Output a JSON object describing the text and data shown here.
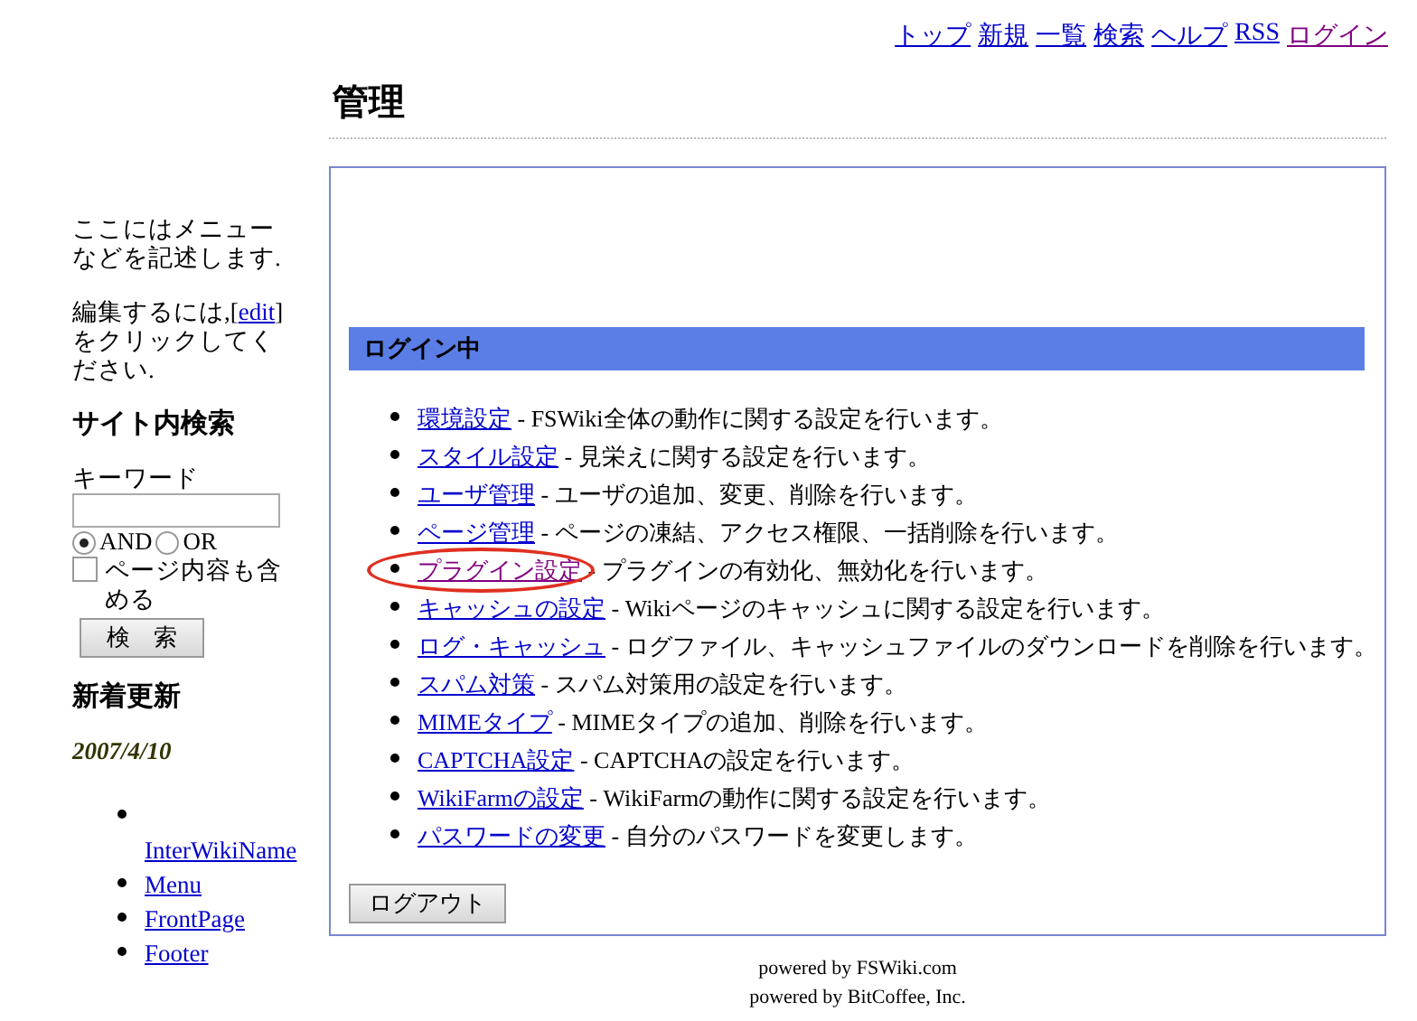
{
  "top_nav": [
    {
      "label": "トップ",
      "visited": false
    },
    {
      "label": "新規",
      "visited": false
    },
    {
      "label": "一覧",
      "visited": false
    },
    {
      "label": "検索",
      "visited": false
    },
    {
      "label": "ヘルプ",
      "visited": false
    },
    {
      "label": "RSS",
      "visited": false
    },
    {
      "label": "ログイン",
      "visited": true
    }
  ],
  "sidebar": {
    "intro": "ここにはメニューなどを記述します.",
    "edit_before": "編集するには,",
    "edit_open": "[",
    "edit_link": "edit",
    "edit_close": "]",
    "edit_after": "をクリックしてください.",
    "search_heading": "サイト内検索",
    "keyword_label": "キーワード",
    "modes": [
      {
        "label": "AND",
        "selected": true
      },
      {
        "label": "OR",
        "selected": false
      }
    ],
    "include_content": {
      "label": "ページ内容も含める",
      "checked": false
    },
    "search_button": "検　索",
    "recent_heading": "新着更新",
    "recent_date": "2007/4/10",
    "recent_pages": [
      "InterWikiName",
      "Menu",
      "FrontPage",
      "Footer"
    ]
  },
  "page_title": "管理",
  "panel": {
    "heading": "ログイン中",
    "items": [
      {
        "link": "環境設定",
        "desc": " - FSWiki全体の動作に関する設定を行います。",
        "visited": false,
        "circled": false
      },
      {
        "link": "スタイル設定",
        "desc": " - 見栄えに関する設定を行います。",
        "visited": false,
        "circled": false
      },
      {
        "link": "ユーザ管理",
        "desc": " - ユーザの追加、変更、削除を行います。",
        "visited": false,
        "circled": false
      },
      {
        "link": "ページ管理",
        "desc": " - ページの凍結、アクセス権限、一括削除を行います。",
        "visited": false,
        "circled": false
      },
      {
        "link": "プラグイン設定",
        "desc": " - プラグインの有効化、無効化を行います。",
        "visited": true,
        "circled": true
      },
      {
        "link": "キャッシュの設定",
        "desc": " - Wikiページのキャッシュに関する設定を行います。",
        "visited": false,
        "circled": false
      },
      {
        "link": "ログ・キャッシュ",
        "desc": " - ログファイル、キャッシュファイルのダウンロードを削除を行います。",
        "visited": false,
        "circled": false
      },
      {
        "link": "スパム対策",
        "desc": " - スパム対策用の設定を行います。",
        "visited": false,
        "circled": false
      },
      {
        "link": "MIMEタイプ",
        "desc": " - MIMEタイプの追加、削除を行います。",
        "visited": false,
        "circled": false
      },
      {
        "link": "CAPTCHA設定",
        "desc": " - CAPTCHAの設定を行います。",
        "visited": false,
        "circled": false
      },
      {
        "link": "WikiFarmの設定",
        "desc": " - WikiFarmの動作に関する設定を行います。",
        "visited": false,
        "circled": false
      },
      {
        "link": "パスワードの変更",
        "desc": " - 自分のパスワードを変更します。",
        "visited": false,
        "circled": false
      }
    ],
    "logout_button": "ログアウト"
  },
  "footer": [
    "powered by FSWiki.com",
    "powered by BitCoffee, Inc."
  ]
}
